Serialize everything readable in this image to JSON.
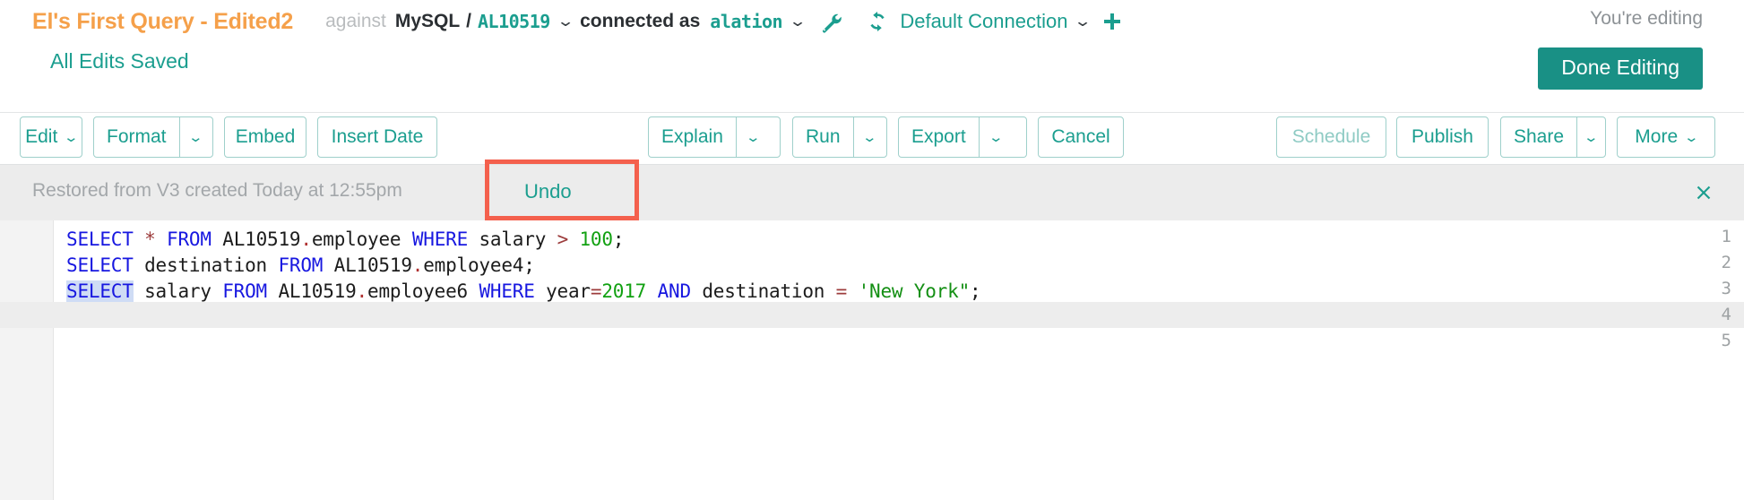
{
  "header": {
    "query_title": "El's First Query - Edited2",
    "against_label": "against",
    "datasource": "MySQL",
    "separator": "/",
    "schema": "AL10519",
    "connected_as_label": "connected as",
    "user": "alation",
    "wrench_icon": "wrench-icon",
    "refresh_icon": "refresh-icon",
    "connection_name": "Default Connection",
    "plus_icon": "plus-icon",
    "editing_status": "You're editing",
    "caret_glyph": "⌄"
  },
  "save_bar": {
    "saved_label": "All Edits Saved",
    "done_editing_label": "Done Editing"
  },
  "toolbar": {
    "left_group": [
      {
        "label": "Edit",
        "type": "dropdown-inline",
        "disabled": false
      },
      {
        "label": "Format",
        "type": "split",
        "disabled": false
      },
      {
        "label": "Embed",
        "type": "plain",
        "disabled": false
      },
      {
        "label": "Insert Date",
        "type": "plain",
        "disabled": false
      }
    ],
    "center_group": [
      {
        "label": "Explain",
        "type": "split",
        "disabled": false
      },
      {
        "label": "Run",
        "type": "split",
        "disabled": false
      },
      {
        "label": "Export",
        "type": "split",
        "disabled": false
      },
      {
        "label": "Cancel",
        "type": "plain",
        "disabled": false
      }
    ],
    "right_group": [
      {
        "label": "Schedule",
        "type": "plain",
        "disabled": true
      },
      {
        "label": "Publish",
        "type": "plain",
        "disabled": false
      },
      {
        "label": "Share",
        "type": "split",
        "disabled": false
      },
      {
        "label": "More",
        "type": "dropdown-inline",
        "disabled": false
      }
    ]
  },
  "notification": {
    "message": "Restored from V3 created Today at 12:55pm",
    "undo_label": "Undo",
    "close_icon": "close-icon",
    "highlight_color": "#f4604d"
  },
  "editor": {
    "line_numbers": [
      "1",
      "2",
      "3",
      "4",
      "5"
    ],
    "active_line": 4,
    "lines": [
      {
        "n": 1,
        "tokens": [
          {
            "t": "SELECT",
            "c": "kw"
          },
          {
            "t": " ",
            "c": "plain"
          },
          {
            "t": "*",
            "c": "op"
          },
          {
            "t": " ",
            "c": "plain"
          },
          {
            "t": "FROM",
            "c": "kw"
          },
          {
            "t": " AL10519",
            "c": "plain"
          },
          {
            "t": ".",
            "c": "dot"
          },
          {
            "t": "employee ",
            "c": "plain"
          },
          {
            "t": "WHERE",
            "c": "kw"
          },
          {
            "t": " salary ",
            "c": "plain"
          },
          {
            "t": ">",
            "c": "op"
          },
          {
            "t": " ",
            "c": "plain"
          },
          {
            "t": "100",
            "c": "num"
          },
          {
            "t": ";",
            "c": "plain"
          }
        ]
      },
      {
        "n": 2,
        "tokens": [
          {
            "t": "SELECT",
            "c": "kw"
          },
          {
            "t": " destination ",
            "c": "plain"
          },
          {
            "t": "FROM",
            "c": "kw"
          },
          {
            "t": " AL10519",
            "c": "plain"
          },
          {
            "t": ".",
            "c": "dot"
          },
          {
            "t": "employee4;",
            "c": "plain"
          }
        ]
      },
      {
        "n": 3,
        "tokens": [
          {
            "t": "SELECT",
            "c": "kw sel"
          },
          {
            "t": " salary ",
            "c": "plain"
          },
          {
            "t": "FROM",
            "c": "kw"
          },
          {
            "t": " AL10519",
            "c": "plain"
          },
          {
            "t": ".",
            "c": "dot"
          },
          {
            "t": "employee6 ",
            "c": "plain"
          },
          {
            "t": "WHERE",
            "c": "kw"
          },
          {
            "t": " year",
            "c": "plain"
          },
          {
            "t": "=",
            "c": "op"
          },
          {
            "t": "2017",
            "c": "num"
          },
          {
            "t": " ",
            "c": "plain"
          },
          {
            "t": "AND",
            "c": "kw"
          },
          {
            "t": " destination ",
            "c": "plain"
          },
          {
            "t": "=",
            "c": "op"
          },
          {
            "t": " ",
            "c": "plain"
          },
          {
            "t": "'New York\"",
            "c": "str"
          },
          {
            "t": ";",
            "c": "plain"
          }
        ]
      },
      {
        "n": 4,
        "tokens": []
      },
      {
        "n": 5,
        "tokens": []
      }
    ],
    "raw_text": "SELECT * FROM AL10519.employee WHERE salary > 100;\nSELECT destination FROM AL10519.employee4;\nSELECT salary FROM AL10519.employee6 WHERE year=2017 AND destination = 'New York\";\n\n"
  },
  "colors": {
    "brand_teal": "#1b9e8f",
    "title_orange": "#f5a04a",
    "keyword_blue": "#1717e0",
    "string_green": "#148f14",
    "highlight_red": "#f4604d",
    "button_teal_bg": "#199085"
  }
}
